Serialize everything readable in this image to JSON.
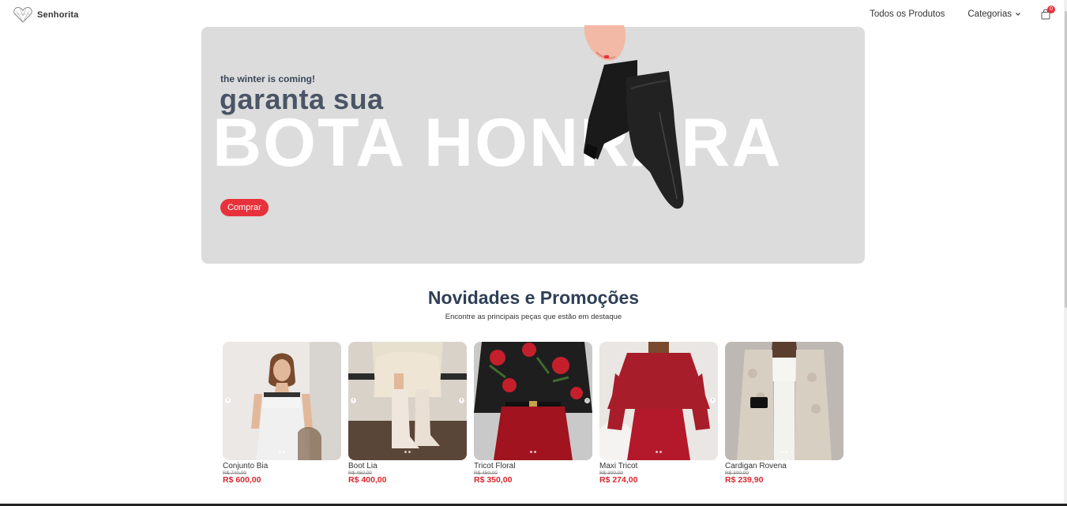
{
  "header": {
    "brand": "Senhorita",
    "nav": {
      "all_products": "Todos os Produtos",
      "categories": "Categorias"
    },
    "cart_count": "0"
  },
  "hero": {
    "kicker": "the winter is coming!",
    "title": "garanta sua",
    "big_text": "BOTA HONRARA",
    "button": "Comprar"
  },
  "section": {
    "title": "Novidades e Promoções",
    "subtitle": "Encontre as principais peças que estão em destaque"
  },
  "products": [
    {
      "name": "Conjunto Bia",
      "old_price": "R$ 740,00",
      "price": "R$ 600,00"
    },
    {
      "name": "Boot Lia",
      "old_price": "R$ 450,00",
      "price": "R$ 400,00"
    },
    {
      "name": "Tricot Floral",
      "old_price": "R$ 450,00",
      "price": "R$ 350,00"
    },
    {
      "name": "Maxi Tricot",
      "old_price": "R$ 300,00",
      "price": "R$ 274,00"
    },
    {
      "name": "Cardigan Rovena",
      "old_price": "R$ 300,00",
      "price": "R$ 239,90"
    }
  ],
  "colors": {
    "accent": "#e8323b",
    "heading": "#2f4057",
    "hero_bg": "#dcdcdc"
  }
}
